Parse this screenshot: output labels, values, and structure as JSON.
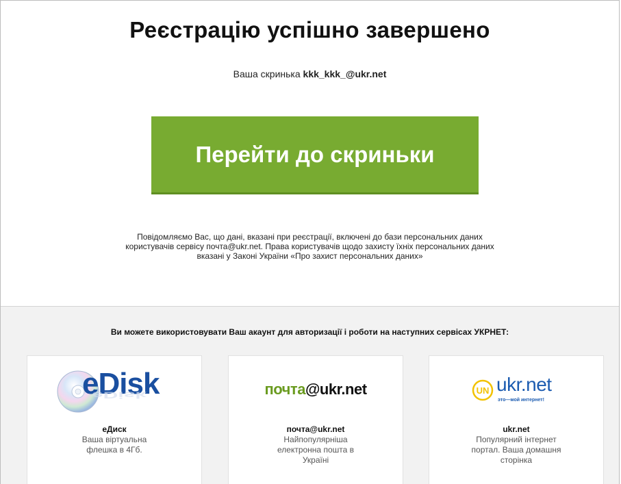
{
  "header": {
    "title": "Реєстрацію успішно завершено",
    "mailbox_prefix": "Ваша скринька",
    "mailbox_address": "kkk_kkk_@ukr.net"
  },
  "cta": {
    "label": "Перейти до скриньки",
    "color": "#78ab31"
  },
  "notice": {
    "line1": "Повідомляємо Вас, що дані, вказані при реєстрації, включені до бази персональних даних",
    "line2": "користувачів сервісу почта@ukr.net. Права користувачів щодо захисту їхніх персональних даних",
    "line3": "вказані у Законі України «Про захист персональних даних»"
  },
  "services": {
    "heading": "Ви можете використовувати Ваш акаунт для авторизації і роботи на наступних сервісах УКРНЕТ:",
    "items": [
      {
        "logo_text": "eDisk",
        "logo_icon": "edisk-logo-icon",
        "name": "eДиск",
        "desc": "Ваша віртуальна флешка в 4Гб."
      },
      {
        "logo_text_part1": "почта",
        "logo_text_part2": "@ukr.net",
        "logo_icon": "pochta-logo-icon",
        "name": "почта@ukr.net",
        "desc": "Найпопулярніша електронна пошта в Україні"
      },
      {
        "logo_text": "ukr.net",
        "logo_slogan": "это—мой интернет!",
        "logo_icon": "ukrnet-logo-icon",
        "name": "ukr.net",
        "desc": "Популярний інтернет портал. Ваша домашня сторінка"
      }
    ]
  }
}
